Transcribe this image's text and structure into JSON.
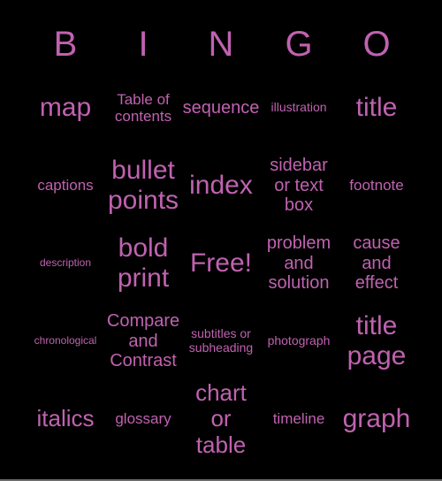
{
  "card": {
    "background_color": "#000000",
    "text_color": "#c062b0",
    "bottom_edge_color": "#6b6b6b"
  },
  "header": {
    "letters": [
      {
        "label": "B"
      },
      {
        "label": "I"
      },
      {
        "label": "N"
      },
      {
        "label": "G"
      },
      {
        "label": "O"
      }
    ]
  },
  "grid": {
    "rows": 5,
    "columns": 5,
    "cells": [
      {
        "label": "map",
        "size": "fs-xxl"
      },
      {
        "label": "Table of contents",
        "size": "fs-md"
      },
      {
        "label": "sequence",
        "size": "fs-lg"
      },
      {
        "label": "illustration",
        "size": "fs-sm"
      },
      {
        "label": "title",
        "size": "fs-xxl"
      },
      {
        "label": "captions",
        "size": "fs-md"
      },
      {
        "label": "bullet points",
        "size": "fs-xxl"
      },
      {
        "label": "index",
        "size": "fs-xxl"
      },
      {
        "label": "sidebar or text box",
        "size": "fs-lg"
      },
      {
        "label": "footnote",
        "size": "fs-md"
      },
      {
        "label": "description",
        "size": "fs-xs"
      },
      {
        "label": "bold print",
        "size": "fs-xxl"
      },
      {
        "label": "Free!",
        "size": "fs-xxl"
      },
      {
        "label": "problem and solution",
        "size": "fs-lg"
      },
      {
        "label": "cause and effect",
        "size": "fs-lg"
      },
      {
        "label": "chronological",
        "size": "fs-xs"
      },
      {
        "label": "Compare and Contrast",
        "size": "fs-lg"
      },
      {
        "label": "subtitles or subheading",
        "size": "fs-sm"
      },
      {
        "label": "photograph",
        "size": "fs-sm"
      },
      {
        "label": "title page",
        "size": "fs-xxl"
      },
      {
        "label": "italics",
        "size": "fs-xl"
      },
      {
        "label": "glossary",
        "size": "fs-md"
      },
      {
        "label": "chart or table",
        "size": "fs-xl"
      },
      {
        "label": "timeline",
        "size": "fs-md"
      },
      {
        "label": "graph",
        "size": "fs-xxl"
      }
    ]
  }
}
